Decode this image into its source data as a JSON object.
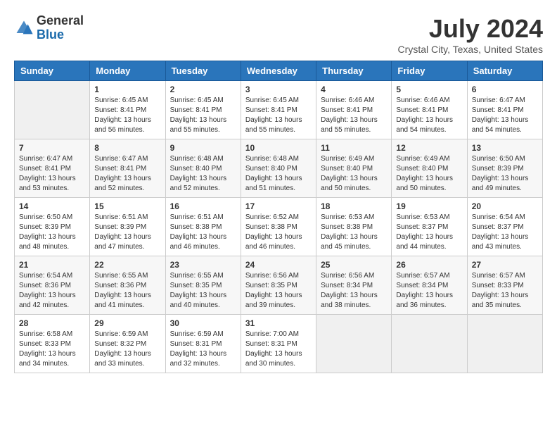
{
  "logo": {
    "general": "General",
    "blue": "Blue"
  },
  "header": {
    "month_year": "July 2024",
    "location": "Crystal City, Texas, United States"
  },
  "weekdays": [
    "Sunday",
    "Monday",
    "Tuesday",
    "Wednesday",
    "Thursday",
    "Friday",
    "Saturday"
  ],
  "weeks": [
    [
      {
        "day": "",
        "sunrise": "",
        "sunset": "",
        "daylight": ""
      },
      {
        "day": "1",
        "sunrise": "Sunrise: 6:45 AM",
        "sunset": "Sunset: 8:41 PM",
        "daylight": "Daylight: 13 hours and 56 minutes."
      },
      {
        "day": "2",
        "sunrise": "Sunrise: 6:45 AM",
        "sunset": "Sunset: 8:41 PM",
        "daylight": "Daylight: 13 hours and 55 minutes."
      },
      {
        "day": "3",
        "sunrise": "Sunrise: 6:45 AM",
        "sunset": "Sunset: 8:41 PM",
        "daylight": "Daylight: 13 hours and 55 minutes."
      },
      {
        "day": "4",
        "sunrise": "Sunrise: 6:46 AM",
        "sunset": "Sunset: 8:41 PM",
        "daylight": "Daylight: 13 hours and 55 minutes."
      },
      {
        "day": "5",
        "sunrise": "Sunrise: 6:46 AM",
        "sunset": "Sunset: 8:41 PM",
        "daylight": "Daylight: 13 hours and 54 minutes."
      },
      {
        "day": "6",
        "sunrise": "Sunrise: 6:47 AM",
        "sunset": "Sunset: 8:41 PM",
        "daylight": "Daylight: 13 hours and 54 minutes."
      }
    ],
    [
      {
        "day": "7",
        "sunrise": "Sunrise: 6:47 AM",
        "sunset": "Sunset: 8:41 PM",
        "daylight": "Daylight: 13 hours and 53 minutes."
      },
      {
        "day": "8",
        "sunrise": "Sunrise: 6:47 AM",
        "sunset": "Sunset: 8:41 PM",
        "daylight": "Daylight: 13 hours and 52 minutes."
      },
      {
        "day": "9",
        "sunrise": "Sunrise: 6:48 AM",
        "sunset": "Sunset: 8:40 PM",
        "daylight": "Daylight: 13 hours and 52 minutes."
      },
      {
        "day": "10",
        "sunrise": "Sunrise: 6:48 AM",
        "sunset": "Sunset: 8:40 PM",
        "daylight": "Daylight: 13 hours and 51 minutes."
      },
      {
        "day": "11",
        "sunrise": "Sunrise: 6:49 AM",
        "sunset": "Sunset: 8:40 PM",
        "daylight": "Daylight: 13 hours and 50 minutes."
      },
      {
        "day": "12",
        "sunrise": "Sunrise: 6:49 AM",
        "sunset": "Sunset: 8:40 PM",
        "daylight": "Daylight: 13 hours and 50 minutes."
      },
      {
        "day": "13",
        "sunrise": "Sunrise: 6:50 AM",
        "sunset": "Sunset: 8:39 PM",
        "daylight": "Daylight: 13 hours and 49 minutes."
      }
    ],
    [
      {
        "day": "14",
        "sunrise": "Sunrise: 6:50 AM",
        "sunset": "Sunset: 8:39 PM",
        "daylight": "Daylight: 13 hours and 48 minutes."
      },
      {
        "day": "15",
        "sunrise": "Sunrise: 6:51 AM",
        "sunset": "Sunset: 8:39 PM",
        "daylight": "Daylight: 13 hours and 47 minutes."
      },
      {
        "day": "16",
        "sunrise": "Sunrise: 6:51 AM",
        "sunset": "Sunset: 8:38 PM",
        "daylight": "Daylight: 13 hours and 46 minutes."
      },
      {
        "day": "17",
        "sunrise": "Sunrise: 6:52 AM",
        "sunset": "Sunset: 8:38 PM",
        "daylight": "Daylight: 13 hours and 46 minutes."
      },
      {
        "day": "18",
        "sunrise": "Sunrise: 6:53 AM",
        "sunset": "Sunset: 8:38 PM",
        "daylight": "Daylight: 13 hours and 45 minutes."
      },
      {
        "day": "19",
        "sunrise": "Sunrise: 6:53 AM",
        "sunset": "Sunset: 8:37 PM",
        "daylight": "Daylight: 13 hours and 44 minutes."
      },
      {
        "day": "20",
        "sunrise": "Sunrise: 6:54 AM",
        "sunset": "Sunset: 8:37 PM",
        "daylight": "Daylight: 13 hours and 43 minutes."
      }
    ],
    [
      {
        "day": "21",
        "sunrise": "Sunrise: 6:54 AM",
        "sunset": "Sunset: 8:36 PM",
        "daylight": "Daylight: 13 hours and 42 minutes."
      },
      {
        "day": "22",
        "sunrise": "Sunrise: 6:55 AM",
        "sunset": "Sunset: 8:36 PM",
        "daylight": "Daylight: 13 hours and 41 minutes."
      },
      {
        "day": "23",
        "sunrise": "Sunrise: 6:55 AM",
        "sunset": "Sunset: 8:35 PM",
        "daylight": "Daylight: 13 hours and 40 minutes."
      },
      {
        "day": "24",
        "sunrise": "Sunrise: 6:56 AM",
        "sunset": "Sunset: 8:35 PM",
        "daylight": "Daylight: 13 hours and 39 minutes."
      },
      {
        "day": "25",
        "sunrise": "Sunrise: 6:56 AM",
        "sunset": "Sunset: 8:34 PM",
        "daylight": "Daylight: 13 hours and 38 minutes."
      },
      {
        "day": "26",
        "sunrise": "Sunrise: 6:57 AM",
        "sunset": "Sunset: 8:34 PM",
        "daylight": "Daylight: 13 hours and 36 minutes."
      },
      {
        "day": "27",
        "sunrise": "Sunrise: 6:57 AM",
        "sunset": "Sunset: 8:33 PM",
        "daylight": "Daylight: 13 hours and 35 minutes."
      }
    ],
    [
      {
        "day": "28",
        "sunrise": "Sunrise: 6:58 AM",
        "sunset": "Sunset: 8:33 PM",
        "daylight": "Daylight: 13 hours and 34 minutes."
      },
      {
        "day": "29",
        "sunrise": "Sunrise: 6:59 AM",
        "sunset": "Sunset: 8:32 PM",
        "daylight": "Daylight: 13 hours and 33 minutes."
      },
      {
        "day": "30",
        "sunrise": "Sunrise: 6:59 AM",
        "sunset": "Sunset: 8:31 PM",
        "daylight": "Daylight: 13 hours and 32 minutes."
      },
      {
        "day": "31",
        "sunrise": "Sunrise: 7:00 AM",
        "sunset": "Sunset: 8:31 PM",
        "daylight": "Daylight: 13 hours and 30 minutes."
      },
      {
        "day": "",
        "sunrise": "",
        "sunset": "",
        "daylight": ""
      },
      {
        "day": "",
        "sunrise": "",
        "sunset": "",
        "daylight": ""
      },
      {
        "day": "",
        "sunrise": "",
        "sunset": "",
        "daylight": ""
      }
    ]
  ]
}
